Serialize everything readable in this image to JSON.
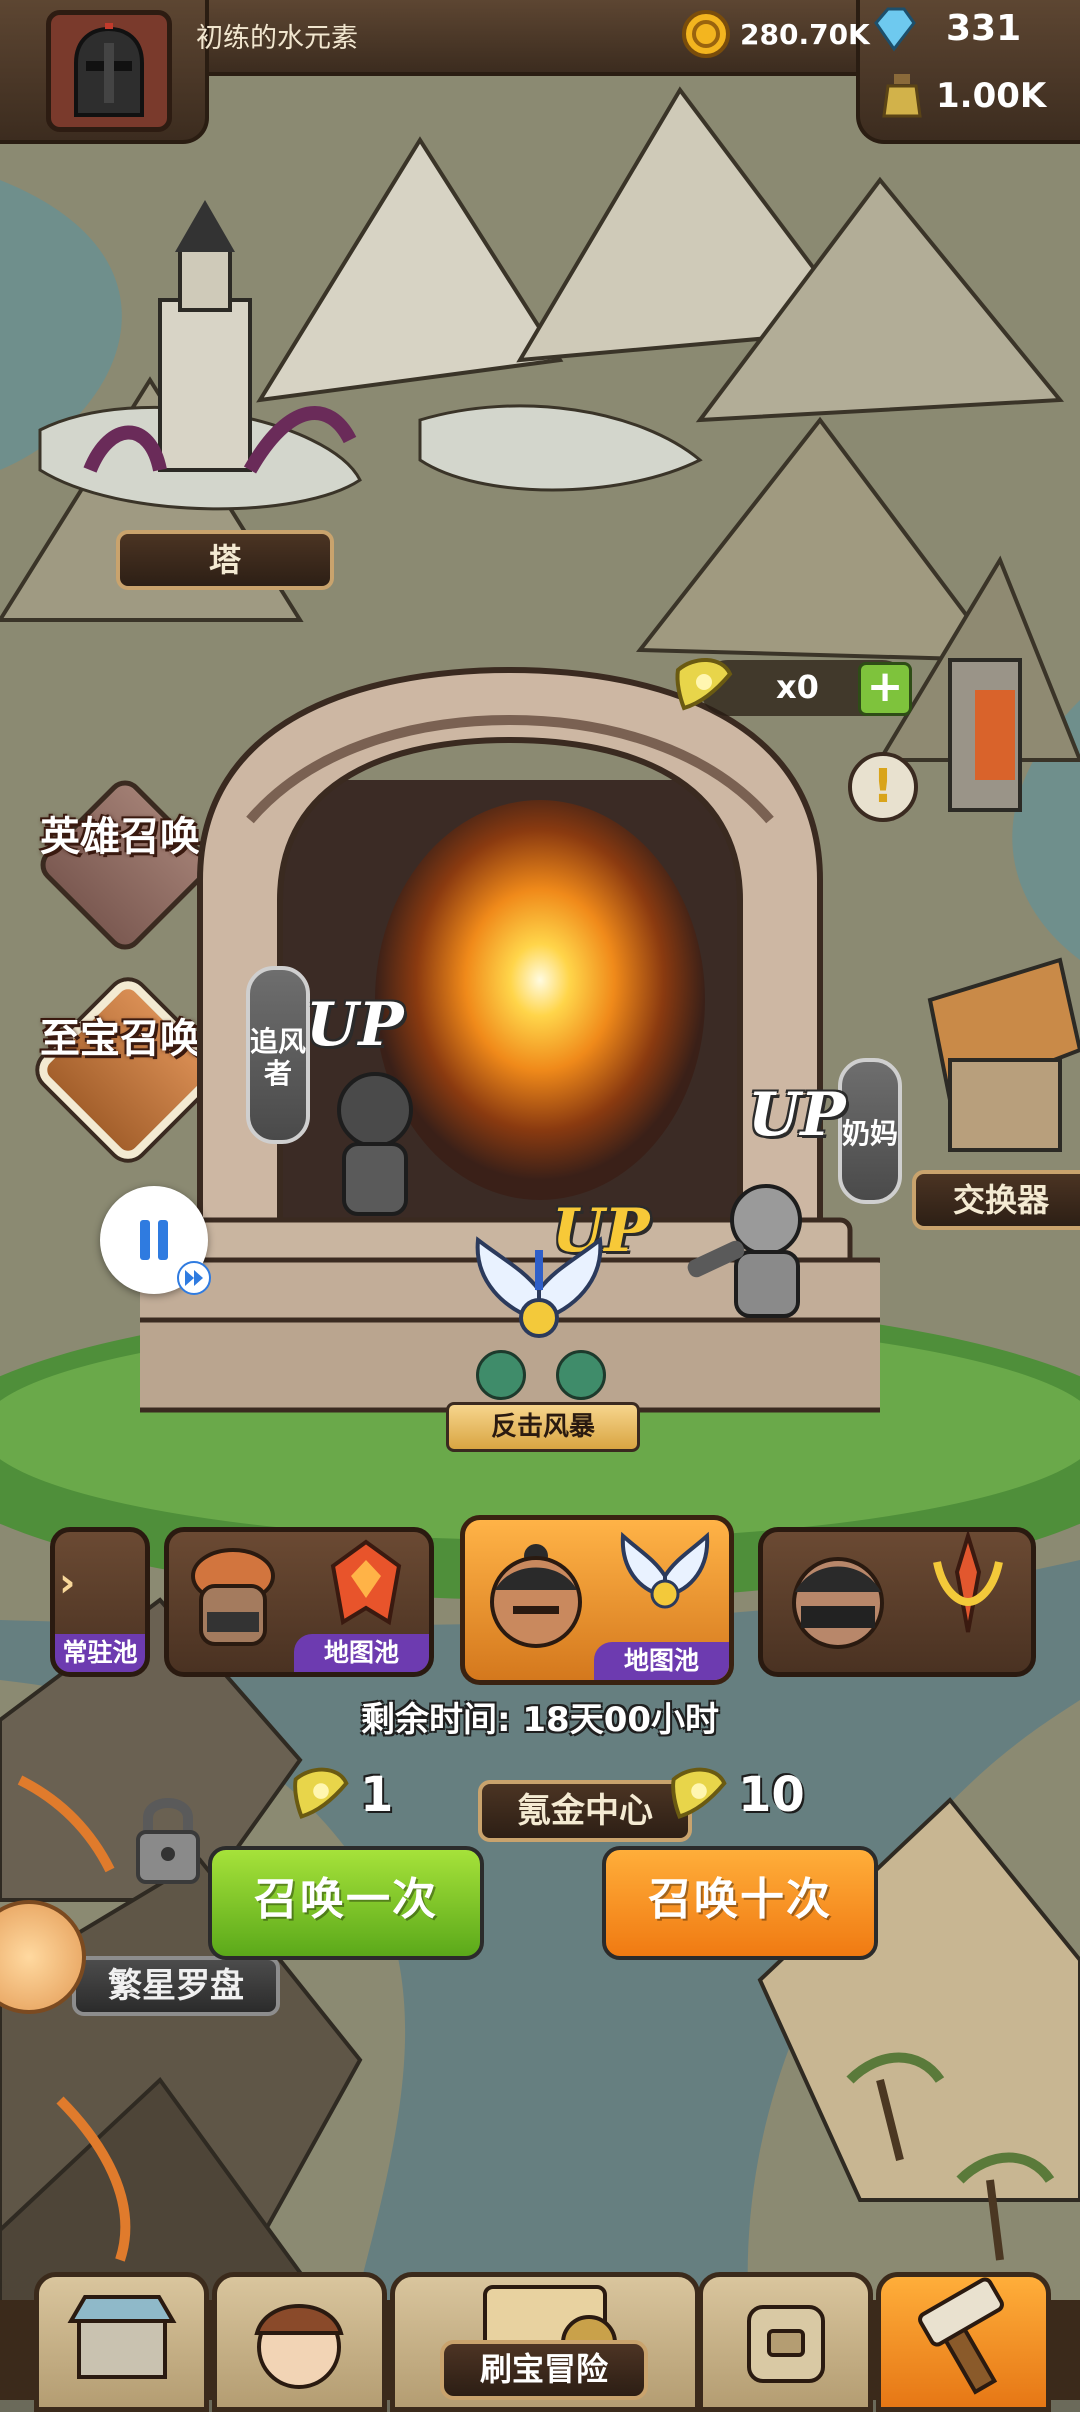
{
  "player": {
    "name": "初练的水元素"
  },
  "resources": {
    "gold": "280.70K",
    "gems": "331",
    "potion": "1.00K"
  },
  "map": {
    "tower_label": "塔",
    "exchanger_label": "交换器",
    "krypton_center_label": "氪金中心",
    "star_compass_label": "繁星罗盘"
  },
  "side_menu": {
    "hero_summon": "英雄召唤",
    "treasure_summon": "至宝召唤"
  },
  "portal": {
    "ticket_count": "x0",
    "left_hero_tag": "追风者",
    "right_hero_tag": "奶妈",
    "up_label": "UP",
    "skill_name": "反击风暴"
  },
  "pools": [
    {
      "tag": "常驻池"
    },
    {
      "tag": "地图池"
    },
    {
      "tag": "地图池",
      "selected": true
    },
    {
      "tag": ""
    }
  ],
  "summon": {
    "remaining_time": "剩余时间: 18天00小时",
    "once_label": "召唤一次",
    "once_cost": "1",
    "ten_label": "召唤十次",
    "ten_cost": "10"
  },
  "bottom_nav": {
    "center_label": "刷宝冒险"
  }
}
